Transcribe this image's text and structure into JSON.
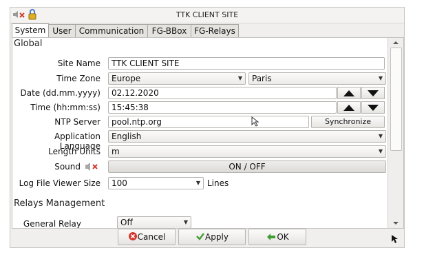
{
  "window": {
    "title": "TTK CLIENT SITE"
  },
  "tabs": [
    "System",
    "User",
    "Communication",
    "FG-BBox",
    "FG-Relays"
  ],
  "sections": {
    "global": "Global",
    "relays": "Relays Management"
  },
  "fields": {
    "site_name": {
      "label": "Site Name",
      "value": "TTK CLIENT SITE"
    },
    "time_zone": {
      "label": "Time Zone",
      "region": "Europe",
      "city": "Paris"
    },
    "date": {
      "label": "Date (dd.mm.yyyy)",
      "value": "02.12.2020"
    },
    "time": {
      "label": "Time (hh:mm:ss)",
      "value": "15:45:38"
    },
    "ntp": {
      "label": "NTP Server",
      "value": "pool.ntp.org",
      "button": "Synchronize"
    },
    "language": {
      "label": "Application Language",
      "value": "English"
    },
    "length_units": {
      "label": "Length Units",
      "value": "m"
    },
    "sound": {
      "label": "Sound",
      "button": "ON / OFF"
    },
    "log_size": {
      "label": "Log File Viewer Size",
      "value": "100",
      "unit": "Lines"
    },
    "general_relay": {
      "label": "General Relay",
      "value": "Off"
    }
  },
  "buttons": {
    "cancel": "Cancel",
    "apply": "Apply",
    "ok": "OK"
  },
  "colors": {
    "cancel_icon": "#d23a2f",
    "apply_icon": "#3f9d2f",
    "ok_icon": "#3f9d2f"
  }
}
